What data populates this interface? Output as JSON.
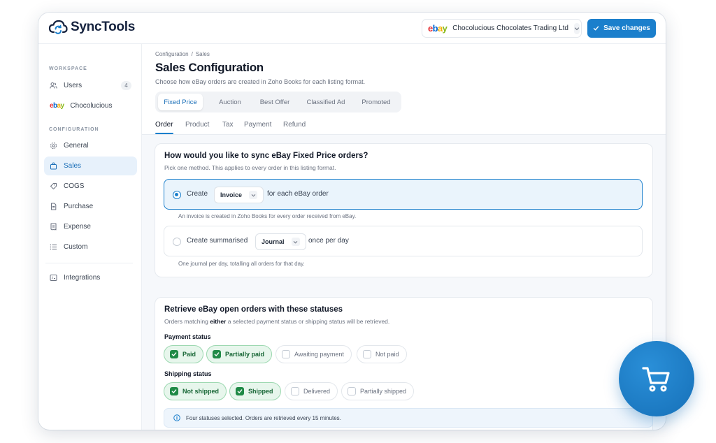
{
  "app": {
    "name": "SyncTools"
  },
  "header": {
    "store_name": "Chocolucious Chocolates Trading Ltd",
    "save_label": "Save changes"
  },
  "sidebar": {
    "workspace_label": "WORKSPACE",
    "configuration_label": "CONFIGURATION",
    "workspace_items": [
      {
        "label": "Users",
        "badge": "4",
        "icon": "users-icon"
      },
      {
        "label": "Chocolucious",
        "icon": "ebay-logo"
      }
    ],
    "config_items": [
      {
        "label": "General",
        "icon": "gear-icon"
      },
      {
        "label": "Sales",
        "icon": "bag-icon",
        "active": true
      },
      {
        "label": "COGS",
        "icon": "tag-icon"
      },
      {
        "label": "Purchase",
        "icon": "document-icon"
      },
      {
        "label": "Expense",
        "icon": "receipt-icon"
      },
      {
        "label": "Custom",
        "icon": "list-icon"
      }
    ],
    "bottom_items": [
      {
        "label": "Integrations",
        "icon": "integrations-icon"
      }
    ]
  },
  "page": {
    "breadcrumb": [
      "Configuration",
      "/",
      "Sales"
    ],
    "title": "Sales Configuration",
    "subtitle": "Choose how eBay orders are created in Zoho Books for each listing format.",
    "format_tabs": [
      "Fixed Price",
      "Auction",
      "Best Offer",
      "Classified Ad",
      "Promoted"
    ],
    "active_format_tab": "Fixed Price",
    "sub_tabs": [
      "Order",
      "Product",
      "Tax",
      "Payment",
      "Refund"
    ],
    "active_sub_tab": "Order"
  },
  "sync_card": {
    "title": "How would you like to sync eBay Fixed Price orders?",
    "subtitle": "Pick one method. This applies to every order in this listing format.",
    "option1": {
      "prefix": "Create",
      "select_value": "Invoice",
      "suffix": "for each eBay order",
      "help": "An invoice is created in Zoho Books for every order received from eBay.",
      "selected": true
    },
    "option2": {
      "prefix": "Create summarised",
      "select_value": "Journal",
      "suffix": "once per day",
      "help": "One journal per day, totalling all orders for that day.",
      "selected": false
    }
  },
  "status_card": {
    "title": "Retrieve eBay open orders with these statuses",
    "subtitle_pre": "Orders matching",
    "subtitle_bold": "either",
    "subtitle_post": "a selected payment status or shipping status will be retrieved.",
    "payment_label": "Payment status",
    "payment_statuses": [
      {
        "label": "Paid",
        "checked": true
      },
      {
        "label": "Partially paid",
        "checked": true
      },
      {
        "label": "Awaiting payment",
        "checked": false
      },
      {
        "label": "Not paid",
        "checked": false
      }
    ],
    "shipping_label": "Shipping status",
    "shipping_statuses": [
      {
        "label": "Not shipped",
        "checked": true
      },
      {
        "label": "Shipped",
        "checked": true
      },
      {
        "label": "Delivered",
        "checked": false
      },
      {
        "label": "Partially shipped",
        "checked": false
      }
    ],
    "info": "Four statuses selected. Orders are retrieved every 15 minutes."
  },
  "colors": {
    "accent": "#1b7fcc",
    "success": "#1f8a46",
    "fab": "#1670b8"
  }
}
